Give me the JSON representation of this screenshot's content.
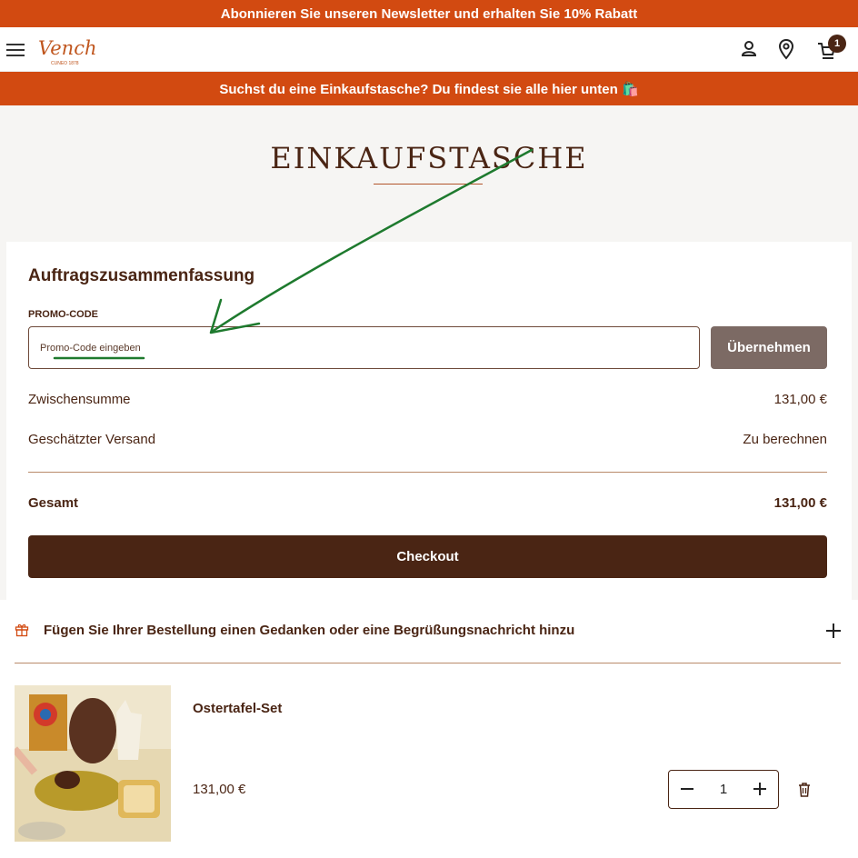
{
  "top_banner": {
    "text": "Abonnieren Sie unseren Newsletter und erhalten Sie 10% Rabatt"
  },
  "header": {
    "brand": "Venchi",
    "brand_sub": "CUNEO 1878",
    "cart_count": "1"
  },
  "promo_banner": {
    "text": "Suchst du eine Einkaufstasche? Du findest sie alle hier unten 🛍️"
  },
  "page": {
    "title": "EINKAUFSTASCHE"
  },
  "summary": {
    "title": "Auftragszusammenfassung",
    "promo_label": "PROMO-CODE",
    "promo_placeholder": "Promo-Code eingeben",
    "apply_label": "Übernehmen",
    "subtotal_label": "Zwischensumme",
    "subtotal_value": "131,00 €",
    "shipping_label": "Geschätzter Versand",
    "shipping_value": "Zu berechnen",
    "total_label": "Gesamt",
    "total_value": "131,00 €",
    "checkout_label": "Checkout"
  },
  "gift": {
    "text": "Fügen Sie Ihrer Bestellung einen Gedanken oder eine Begrüßungsnachricht hinzu"
  },
  "cart_items": [
    {
      "name": "Ostertafel-Set",
      "price": "131,00 €",
      "quantity": "1"
    }
  ],
  "icons": [
    "menu-icon",
    "account-icon",
    "location-pin-icon",
    "cart-icon",
    "gift-icon",
    "plus-icon",
    "minus-icon",
    "trash-icon"
  ],
  "colors": {
    "brand_orange": "#d24a11",
    "chocolate": "#4a2514",
    "apply_button": "#7c6a64",
    "annotation_green": "#1e7a2e"
  }
}
